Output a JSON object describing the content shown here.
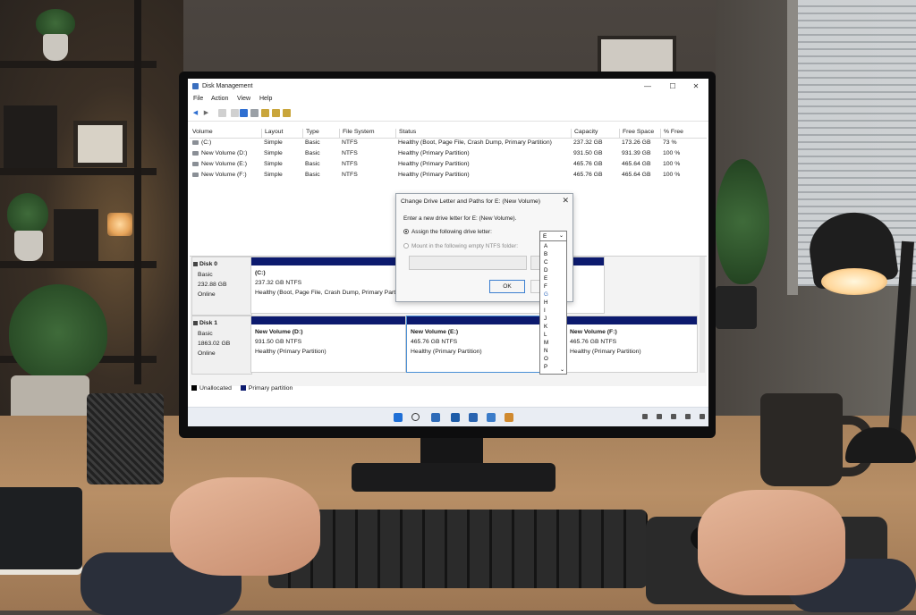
{
  "window": {
    "title": "Disk Management",
    "minimize": "—",
    "maximize": "☐",
    "close": "✕"
  },
  "menu": [
    "File",
    "Action",
    "View",
    "Help"
  ],
  "volume_table": {
    "headers": [
      "Volume",
      "Layout",
      "Type",
      "File System",
      "Status",
      "Capacity",
      "Free Space",
      "% Free"
    ],
    "rows": [
      [
        "(C:)",
        "Simple",
        "Basic",
        "NTFS",
        "Healthy (Boot, Page File, Crash Dump, Primary Partition)",
        "237.32 GB",
        "173.26 GB",
        "73 %"
      ],
      [
        "New Volume (D:)",
        "Simple",
        "Basic",
        "NTFS",
        "Healthy (Primary Partition)",
        "931.50 GB",
        "931.39 GB",
        "100 %"
      ],
      [
        "New Volume (E:)",
        "Simple",
        "Basic",
        "NTFS",
        "Healthy (Primary Partition)",
        "465.76 GB",
        "465.64 GB",
        "100 %"
      ],
      [
        "New Volume (F:)",
        "Simple",
        "Basic",
        "NTFS",
        "Healthy (Primary Partition)",
        "465.76 GB",
        "465.64 GB",
        "100 %"
      ]
    ]
  },
  "disks": [
    {
      "name": "Disk 0",
      "type": "Basic",
      "size": "232.88 GB",
      "status": "Online",
      "partitions": [
        {
          "name": "(C:)",
          "size": "237.32 GB NTFS",
          "status": "Healthy (Boot, Page File, Crash Dump, Primary Partitio"
        }
      ]
    },
    {
      "name": "Disk 1",
      "type": "Basic",
      "size": "1863.02 GB",
      "status": "Online",
      "partitions": [
        {
          "name": "New Volume (D:)",
          "size": "931.50 GB NTFS",
          "status": "Healthy (Primary Partition)"
        },
        {
          "name": "New Volume (E:)",
          "size": "465.76 GB NTFS",
          "status": "Healthy (Primary Partition)"
        },
        {
          "name": "New Volume (F:)",
          "size": "465.76 GB NTFS",
          "status": "Healthy (Primary Partition)"
        }
      ]
    }
  ],
  "legend": {
    "unallocated": "Unallocated",
    "primary": "Primary partition"
  },
  "dialog": {
    "title": "Change Drive Letter and Paths for E: (New Volume)",
    "prompt": "Enter a new drive letter for E: (New Volume).",
    "option_assign": "Assign the following drive letter:",
    "option_mount": "Mount in the following empty NTFS folder:",
    "ok": "OK",
    "close": "✕",
    "selected_letter": "E",
    "letters": [
      "A",
      "B",
      "C",
      "D",
      "E",
      "F",
      "G",
      "H",
      "I",
      "J",
      "K",
      "L",
      "M",
      "N",
      "O",
      "P"
    ],
    "highlighted_letter": "G"
  },
  "colors": {
    "primary_partition": "#0c1a6e",
    "unallocated": "#000000",
    "selection": "#4a8fd6"
  },
  "icons": {
    "toolbar": [
      "back-icon",
      "forward-icon",
      "properties-icon",
      "help-icon",
      "disk-icon",
      "refresh-icon",
      "connect-icon",
      "delete-icon",
      "settings-icon"
    ],
    "taskbar": [
      "windows-start-icon",
      "search-icon",
      "file-explorer-icon",
      "edge-icon",
      "store-icon",
      "mail-icon",
      "disk-management-icon"
    ]
  }
}
